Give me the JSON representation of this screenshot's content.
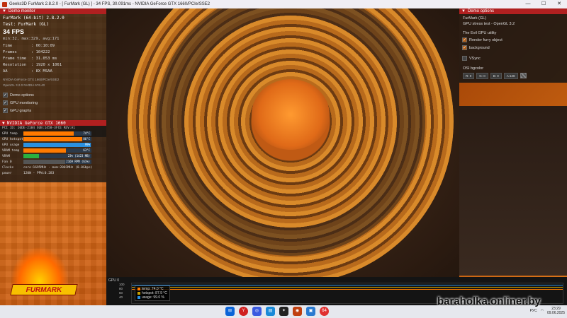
{
  "window": {
    "title": "Geeks3D FurMark 2.8.2.0 - [ FurMark (GL) ] - 34 FPS, 30.091ms - NVIDIA GeForce GTX 1660/PCIe/SSE2",
    "min": "—",
    "max": "☐",
    "close": "✕"
  },
  "monitor": {
    "header": "Demo monitor",
    "app_line": "FurMark (64-bit) 2.8.2.0",
    "test_line": "Test: FurMark (GL)",
    "fps": "34 FPS",
    "minmax": "min:32, max:329, avg:171",
    "stats": [
      {
        "k": "Time",
        "v": ": 00:10:09"
      },
      {
        "k": "Frames",
        "v": ": 104222"
      },
      {
        "k": "Frame time",
        "v": ": 31.053 ms"
      },
      {
        "k": "Resolution",
        "v": ": 1920 x 1061"
      },
      {
        "k": "AA",
        "v": ": 8X MSAA"
      }
    ],
    "renderer": "NVIDIA GeForce GTX 1660/PCIe/SSE2",
    "opengl": "OpenGL 3.2.0 NVIDIA 576.40",
    "options": [
      "Demo options",
      "GPU monitoring",
      "GPU graphs"
    ]
  },
  "gpu": {
    "header": "NVIDIA GeForce GTX 1660",
    "pci": "PCI ID: 10DE-2184 SUB:1458-3FCE REV:A1",
    "rows": [
      {
        "label": "GPU temp",
        "value": "74°C",
        "level": 0.74,
        "color": "#ff7a00"
      },
      {
        "label": "GPU hotspot",
        "value": "86°C",
        "level": 0.86,
        "color": "#ff7a00"
      },
      {
        "label": "GPU usage",
        "value": "99%",
        "level": 0.99,
        "color": "#2a90e0"
      },
      {
        "label": "VRAM temp",
        "value": "63°C",
        "level": 0.63,
        "color": "#ff7a00"
      },
      {
        "label": "VRAM",
        "value": "23% (1423 MB)",
        "level": 0.23,
        "color": "#2ab040"
      },
      {
        "label": "Fan 0",
        "value": "2169 RPM (61%)",
        "level": 0.61,
        "color": "#555555"
      }
    ],
    "clocks_label": "Clocks",
    "clocks_value": "core:1695MHz - mem:2001MHz (8.0Gbps)",
    "power_label": "power",
    "power_value": "120W - PPW:0.283"
  },
  "options": {
    "header": "Demo options",
    "line1": "FurMark (GL)",
    "line2": "GPU stress test - OpenGL 3.2",
    "line3": "The Evil GPU utility",
    "checks": [
      {
        "label": "Render furry object",
        "checked": true
      },
      {
        "label": "background",
        "checked": true
      }
    ],
    "vsync": "VSync",
    "osi_label": "OSI bgcolor",
    "colors": [
      "R: 0",
      "G: 0",
      "B: 0",
      "A:128"
    ]
  },
  "graph": {
    "title": "GPU 0",
    "ticks": [
      "100",
      "80",
      "60",
      "40"
    ],
    "legend": [
      {
        "text": "temp: 74.0 °C",
        "color": "#ff7a00"
      },
      {
        "text": "hotspot: 87.9 °C",
        "color": "#c8a000"
      },
      {
        "text": "usage: 99.0 %",
        "color": "#2a90e0"
      }
    ]
  },
  "logo": {
    "text": "FURMARK"
  },
  "taskbar": {
    "icons": [
      "⊞",
      "Y",
      "◎",
      "▤",
      "✦",
      "◉",
      "▣",
      "64"
    ],
    "lang": "РУС",
    "time": "23:29",
    "date": "09.06.2025"
  },
  "watermark": "baraholka.onliner.by"
}
